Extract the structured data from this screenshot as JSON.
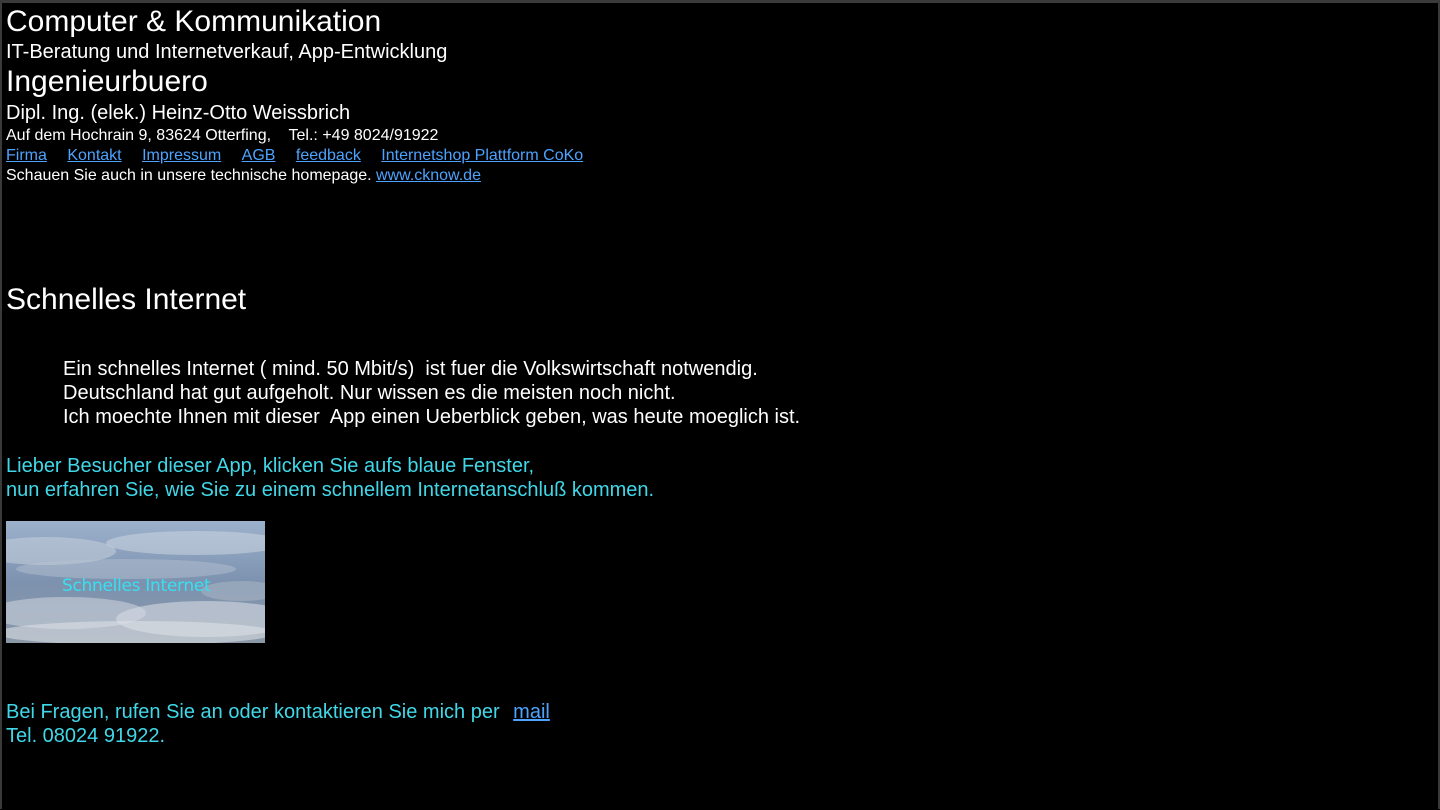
{
  "header": {
    "company": "Computer & Kommunikation",
    "tagline": "IT-Beratung und Internetverkauf, App-Entwicklung",
    "office": "Ingenieurbuero",
    "owner": "Dipl. Ing. (elek.) Heinz-Otto Weissbrich",
    "address": "Auf dem Hochrain 9, 83624 Otterfing,    Tel.: +49 8024/91922"
  },
  "nav": {
    "links": [
      "Firma",
      "Kontakt",
      "Impressum",
      "AGB",
      "feedback",
      "Internetshop Plattform CoKo"
    ]
  },
  "tech": {
    "text": "Schauen Sie auch in unsere technische homepage. ",
    "link": "www.cknow.de"
  },
  "main": {
    "heading": "Schnelles Internet",
    "paragraph": [
      "Ein schnelles Internet ( mind. 50 Mbit/s)  ist fuer die Volkswirtschaft notwendig.",
      "Deutschland hat gut aufgeholt. Nur wissen es die meisten noch nicht.",
      "Ich moechte Ihnen mit dieser  App einen Ueberblick geben, was heute moeglich ist."
    ],
    "visitor": [
      "Lieber Besucher dieser App, klicken Sie aufs blaue Fenster,",
      "nun erfahren Sie, wie Sie zu einem schnellem Internetanschluß kommen."
    ],
    "banner_label": "Schnelles Internet",
    "contact_text": "Bei Fragen, rufen Sie an oder kontaktieren Sie mich per ",
    "contact_link": "mail",
    "phone": "Tel. 08024 91922."
  },
  "colors": {
    "background": "#000000",
    "link": "#4da3ff",
    "accent_text": "#40d8e8"
  }
}
